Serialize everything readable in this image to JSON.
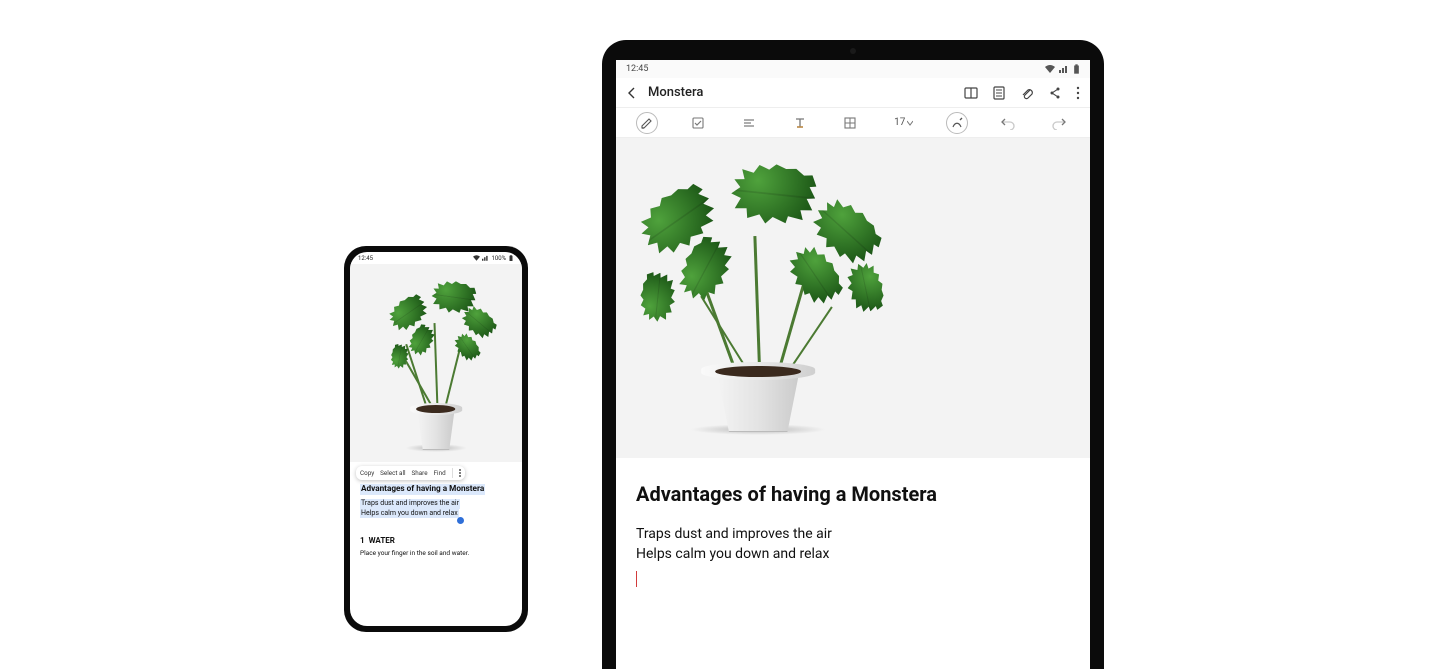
{
  "phone": {
    "status": {
      "time": "12:45",
      "signal": "100%",
      "wifi": true,
      "battery": true
    },
    "context_menu": {
      "copy": "Copy",
      "select_all": "Select all",
      "share": "Share",
      "find": "Find"
    },
    "note": {
      "title": "Advantages of having a Monstera",
      "lines": [
        "Traps dust and improves the air",
        "Helps calm you down and relax"
      ],
      "section_number": "1",
      "section_head": "WATER",
      "section_body": "Place your finger in the soil and water."
    }
  },
  "tablet": {
    "status": {
      "time": "12:45",
      "wifi": true,
      "battery": true
    },
    "appbar": {
      "title": "Monstera",
      "icons": {
        "back": "back",
        "reading": "reading-mode",
        "page_template": "page-template",
        "attach": "attach",
        "share": "share",
        "more": "more"
      }
    },
    "toolbar": {
      "pen": "pen",
      "checkbox": "checkbox",
      "align": "align",
      "text_format": "text-format",
      "table": "table",
      "font_size": "17",
      "stylus": "stylus",
      "undo": "undo",
      "redo": "redo"
    },
    "note": {
      "title": "Advantages of having a Monstera",
      "lines": [
        "Traps dust and improves the air",
        "Helps calm you down and relax"
      ]
    }
  }
}
